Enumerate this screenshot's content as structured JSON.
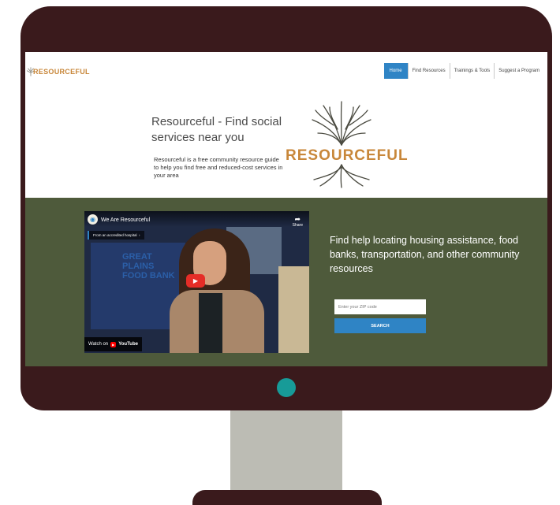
{
  "header": {
    "logo_text": "RESOURCEFUL",
    "nav": [
      {
        "label": "Home",
        "active": true
      },
      {
        "label": "Find Resources",
        "active": false
      },
      {
        "label": "Trainings & Tools",
        "active": false
      },
      {
        "label": "Suggest a Program",
        "active": false
      }
    ]
  },
  "hero": {
    "title": "Resourceful - Find social services near you",
    "subtitle": "Resourceful is a free community resource guide to help you find free and reduced-cost services in your area",
    "logo_word": "RESOURCEFUL"
  },
  "video": {
    "title": "We Are Resourceful",
    "chip_label": "From an accredited hospital",
    "share_label": "Share",
    "sign_text": "GREAT PLAINS FOOD BANK",
    "watch_on_label": "Watch on",
    "youtube_label": "YouTube"
  },
  "band": {
    "text": "Find help locating housing assistance, food banks, transportation, and other community resources",
    "zip_placeholder": "Enter your ZIP code",
    "search_label": "SEARCH"
  },
  "colors": {
    "monitor": "#3a1a1c",
    "power_led": "#179b98",
    "stand": "#bcbcb4",
    "accent_blue": "#2f84c5",
    "brand_orange": "#c8873a",
    "band_green": "#4e5a3b"
  },
  "icons": {
    "share": "share-icon",
    "play": "play-icon",
    "logo": "tree-logo-icon"
  }
}
